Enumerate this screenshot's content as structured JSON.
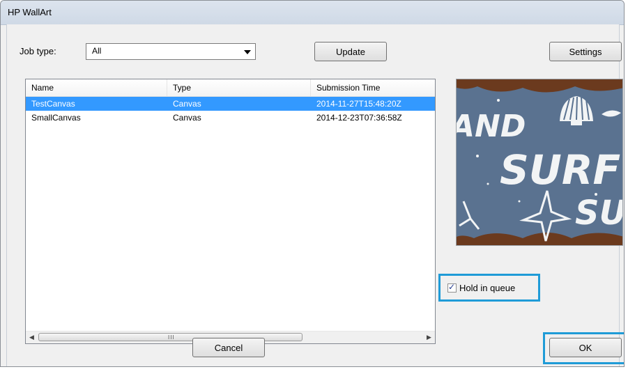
{
  "window": {
    "title": "HP WallArt"
  },
  "toolbar": {
    "job_type_label": "Job type:",
    "job_type_value": "All",
    "update_label": "Update",
    "settings_label": "Settings"
  },
  "jobs": {
    "columns": [
      "Name",
      "Type",
      "Submission Time"
    ],
    "rows": [
      {
        "name": "TestCanvas",
        "type": "Canvas",
        "time": "2014-11-27T15:48:20Z",
        "selected": true
      },
      {
        "name": "SmallCanvas",
        "type": "Canvas",
        "time": "2014-12-23T07:36:58Z",
        "selected": false
      }
    ],
    "scroll_grip": "III"
  },
  "preview": {
    "image_text": [
      "AND",
      "SURF",
      "SU"
    ],
    "colors": {
      "background": "#5a7290",
      "text": "#f2f4f5",
      "rust": "#6b3a1e"
    }
  },
  "options": {
    "hold_in_queue_label": "Hold in queue",
    "hold_in_queue_checked": true
  },
  "footer": {
    "cancel_label": "Cancel",
    "ok_label": "OK"
  },
  "colors": {
    "selection": "#3399ff",
    "highlight": "#1f9bd7"
  }
}
